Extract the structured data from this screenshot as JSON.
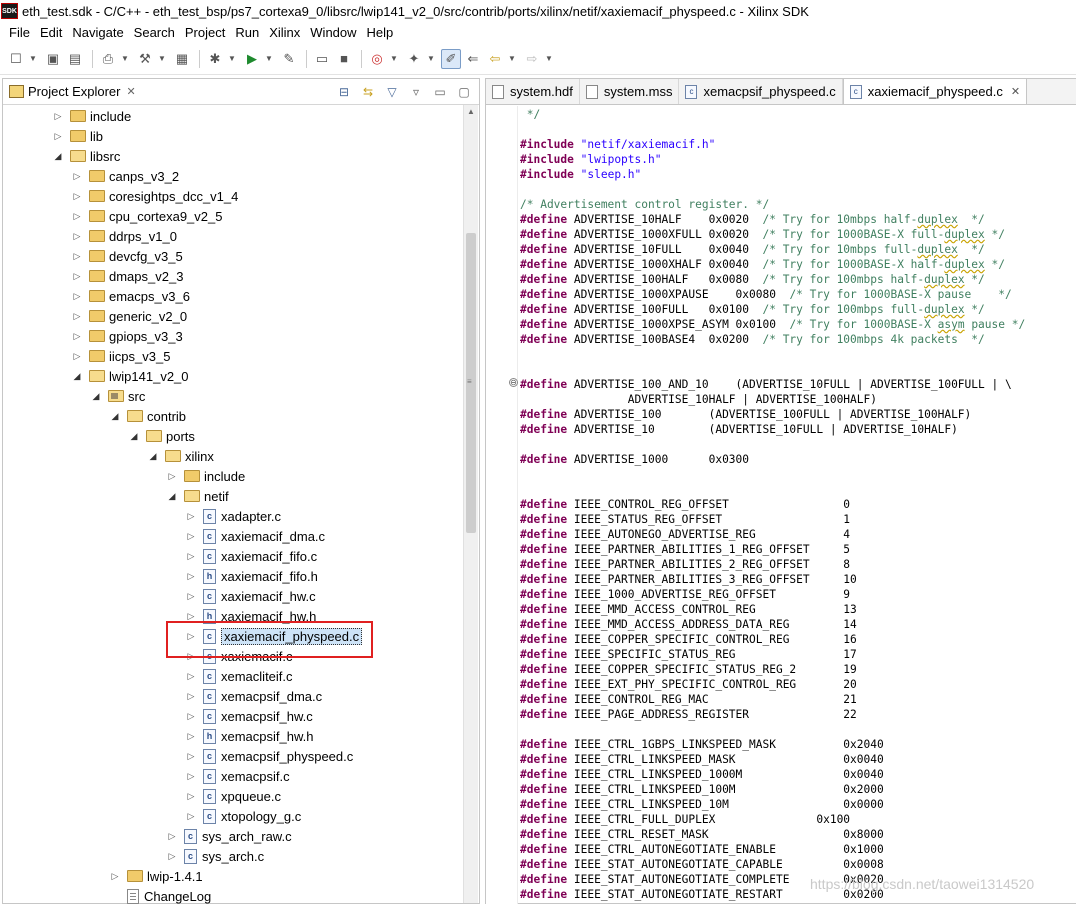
{
  "window": {
    "title": "eth_test.sdk - C/C++ - eth_test_bsp/ps7_cortexa9_0/libsrc/lwip141_v2_0/src/contrib/ports/xilinx/netif/xaxiemacif_physpeed.c - Xilinx SDK",
    "logo_text": "SDK"
  },
  "menu": [
    "File",
    "Edit",
    "Navigate",
    "Search",
    "Project",
    "Run",
    "Xilinx",
    "Window",
    "Help"
  ],
  "toolbar": {
    "icons": [
      "new-icon",
      "save-icon",
      "save-all-icon",
      "print-icon",
      "build-icon",
      "hammer-icon",
      "binary-icon",
      "debug-icon",
      "run-icon",
      "external-tool-icon",
      "terminal-icon",
      "console-icon",
      "target-icon",
      "wand-icon",
      "highlight-icon",
      "back-icon",
      "forward-icon"
    ]
  },
  "project_explorer": {
    "title": "Project Explorer",
    "close_glyph": "✕",
    "tree": [
      {
        "label": "include",
        "type": "folder",
        "depth": 0,
        "expanded": false
      },
      {
        "label": "lib",
        "type": "folder",
        "depth": 0,
        "expanded": false
      },
      {
        "label": "libsrc",
        "type": "folder",
        "depth": 0,
        "expanded": true
      },
      {
        "label": "canps_v3_2",
        "type": "folder",
        "depth": 1,
        "expanded": false
      },
      {
        "label": "coresightps_dcc_v1_4",
        "type": "folder",
        "depth": 1,
        "expanded": false
      },
      {
        "label": "cpu_cortexa9_v2_5",
        "type": "folder",
        "depth": 1,
        "expanded": false
      },
      {
        "label": "ddrps_v1_0",
        "type": "folder",
        "depth": 1,
        "expanded": false
      },
      {
        "label": "devcfg_v3_5",
        "type": "folder",
        "depth": 1,
        "expanded": false
      },
      {
        "label": "dmaps_v2_3",
        "type": "folder",
        "depth": 1,
        "expanded": false
      },
      {
        "label": "emacps_v3_6",
        "type": "folder",
        "depth": 1,
        "expanded": false
      },
      {
        "label": "generic_v2_0",
        "type": "folder",
        "depth": 1,
        "expanded": false
      },
      {
        "label": "gpiops_v3_3",
        "type": "folder",
        "depth": 1,
        "expanded": false
      },
      {
        "label": "iicps_v3_5",
        "type": "folder",
        "depth": 1,
        "expanded": false
      },
      {
        "label": "lwip141_v2_0",
        "type": "folder",
        "depth": 1,
        "expanded": true
      },
      {
        "label": "src",
        "type": "src",
        "depth": 2,
        "expanded": true
      },
      {
        "label": "contrib",
        "type": "folder",
        "depth": 3,
        "expanded": true
      },
      {
        "label": "ports",
        "type": "folder",
        "depth": 4,
        "expanded": true
      },
      {
        "label": "xilinx",
        "type": "folder",
        "depth": 5,
        "expanded": true
      },
      {
        "label": "include",
        "type": "folder",
        "depth": 6,
        "expanded": false
      },
      {
        "label": "netif",
        "type": "folder",
        "depth": 6,
        "expanded": true
      },
      {
        "label": "xadapter.c",
        "type": "c",
        "depth": 7,
        "expanded": false
      },
      {
        "label": "xaxiemacif_dma.c",
        "type": "c",
        "depth": 7,
        "expanded": false
      },
      {
        "label": "xaxiemacif_fifo.c",
        "type": "c",
        "depth": 7,
        "expanded": false
      },
      {
        "label": "xaxiemacif_fifo.h",
        "type": "h",
        "depth": 7,
        "expanded": false
      },
      {
        "label": "xaxiemacif_hw.c",
        "type": "c",
        "depth": 7,
        "expanded": false
      },
      {
        "label": "xaxiemacif_hw.h",
        "type": "h",
        "depth": 7,
        "expanded": false
      },
      {
        "label": "xaxiemacif_physpeed.c",
        "type": "c",
        "depth": 7,
        "expanded": false,
        "selected": true
      },
      {
        "label": "xaxiemacif.c",
        "type": "c",
        "depth": 7,
        "expanded": false
      },
      {
        "label": "xemacliteif.c",
        "type": "c",
        "depth": 7,
        "expanded": false
      },
      {
        "label": "xemacpsif_dma.c",
        "type": "c",
        "depth": 7,
        "expanded": false
      },
      {
        "label": "xemacpsif_hw.c",
        "type": "c",
        "depth": 7,
        "expanded": false
      },
      {
        "label": "xemacpsif_hw.h",
        "type": "h",
        "depth": 7,
        "expanded": false
      },
      {
        "label": "xemacpsif_physpeed.c",
        "type": "c",
        "depth": 7,
        "expanded": false
      },
      {
        "label": "xemacpsif.c",
        "type": "c",
        "depth": 7,
        "expanded": false
      },
      {
        "label": "xpqueue.c",
        "type": "c",
        "depth": 7,
        "expanded": false
      },
      {
        "label": "xtopology_g.c",
        "type": "c",
        "depth": 7,
        "expanded": false
      },
      {
        "label": "sys_arch_raw.c",
        "type": "c",
        "depth": 6,
        "expanded": false
      },
      {
        "label": "sys_arch.c",
        "type": "c",
        "depth": 6,
        "expanded": false
      },
      {
        "label": "lwip-1.4.1",
        "type": "folder",
        "depth": 3,
        "expanded": false
      },
      {
        "label": "ChangeLog",
        "type": "txt",
        "depth": 3,
        "expanded": null
      }
    ]
  },
  "editor": {
    "tabs": [
      {
        "label": "system.hdf",
        "icon": "doc",
        "active": false
      },
      {
        "label": "system.mss",
        "icon": "doc",
        "active": false
      },
      {
        "label": "xemacpsif_physpeed.c",
        "icon": "c",
        "active": false
      },
      {
        "label": "xaxiemacif_physpeed.c",
        "icon": "c",
        "active": true
      }
    ],
    "fold_marker": "⊖",
    "code_lines": [
      [
        [
          "c",
          " */"
        ]
      ],
      [],
      [
        [
          "k",
          "#include"
        ],
        [
          "t",
          " "
        ],
        [
          "s",
          "\"netif/xaxiemacif.h\""
        ]
      ],
      [
        [
          "k",
          "#include"
        ],
        [
          "t",
          " "
        ],
        [
          "s",
          "\"lwipopts.h\""
        ]
      ],
      [
        [
          "k",
          "#include"
        ],
        [
          "t",
          " "
        ],
        [
          "s",
          "\"sleep.h\""
        ]
      ],
      [],
      [
        [
          "c",
          "/* Advertisement control register. */"
        ]
      ],
      [
        [
          "k",
          "#define"
        ],
        [
          "t",
          " ADVERTISE_10HALF    0x0020  "
        ],
        [
          "c",
          "/* Try for 10mbps half-"
        ],
        [
          "q",
          "duplex"
        ],
        [
          "c",
          "  */"
        ]
      ],
      [
        [
          "k",
          "#define"
        ],
        [
          "t",
          " ADVERTISE_1000XFULL 0x0020  "
        ],
        [
          "c",
          "/* Try for 1000BASE-X full-"
        ],
        [
          "q",
          "duplex"
        ],
        [
          "c",
          " */"
        ]
      ],
      [
        [
          "k",
          "#define"
        ],
        [
          "t",
          " ADVERTISE_10FULL    0x0040  "
        ],
        [
          "c",
          "/* Try for 10mbps full-"
        ],
        [
          "q",
          "duplex"
        ],
        [
          "c",
          "  */"
        ]
      ],
      [
        [
          "k",
          "#define"
        ],
        [
          "t",
          " ADVERTISE_1000XHALF 0x0040  "
        ],
        [
          "c",
          "/* Try for 1000BASE-X half-"
        ],
        [
          "q",
          "duplex"
        ],
        [
          "c",
          " */"
        ]
      ],
      [
        [
          "k",
          "#define"
        ],
        [
          "t",
          " ADVERTISE_100HALF   0x0080  "
        ],
        [
          "c",
          "/* Try for 100mbps half-"
        ],
        [
          "q",
          "duplex"
        ],
        [
          "c",
          " */"
        ]
      ],
      [
        [
          "k",
          "#define"
        ],
        [
          "t",
          " ADVERTISE_1000XPAUSE    0x0080  "
        ],
        [
          "c",
          "/* Try for 1000BASE-X pause    */"
        ]
      ],
      [
        [
          "k",
          "#define"
        ],
        [
          "t",
          " ADVERTISE_100FULL   0x0100  "
        ],
        [
          "c",
          "/* Try for 100mbps full-"
        ],
        [
          "q",
          "duplex"
        ],
        [
          "c",
          " */"
        ]
      ],
      [
        [
          "k",
          "#define"
        ],
        [
          "t",
          " ADVERTISE_1000XPSE_ASYM 0x0100  "
        ],
        [
          "c",
          "/* Try for 1000BASE-X "
        ],
        [
          "q",
          "asym"
        ],
        [
          "c",
          " pause */"
        ]
      ],
      [
        [
          "k",
          "#define"
        ],
        [
          "t",
          " ADVERTISE_100BASE4  0x0200  "
        ],
        [
          "c",
          "/* Try for 100mbps 4k packets  */"
        ]
      ],
      [],
      [],
      [
        [
          "k",
          "#define"
        ],
        [
          "t",
          " ADVERTISE_100_AND_10    (ADVERTISE_10FULL | ADVERTISE_100FULL | \\"
        ]
      ],
      [
        [
          "t",
          "                ADVERTISE_10HALF | ADVERTISE_100HALF)"
        ]
      ],
      [
        [
          "k",
          "#define"
        ],
        [
          "t",
          " ADVERTISE_100       (ADVERTISE_100FULL | ADVERTISE_100HALF)"
        ]
      ],
      [
        [
          "k",
          "#define"
        ],
        [
          "t",
          " ADVERTISE_10        (ADVERTISE_10FULL | ADVERTISE_10HALF)"
        ]
      ],
      [],
      [
        [
          "k",
          "#define"
        ],
        [
          "t",
          " ADVERTISE_1000      0x0300"
        ]
      ],
      [],
      [],
      [
        [
          "k",
          "#define"
        ],
        [
          "t",
          " IEEE_CONTROL_REG_OFFSET                 0"
        ]
      ],
      [
        [
          "k",
          "#define"
        ],
        [
          "t",
          " IEEE_STATUS_REG_OFFSET                  1"
        ]
      ],
      [
        [
          "k",
          "#define"
        ],
        [
          "t",
          " IEEE_AUTONEGO_ADVERTISE_REG             4"
        ]
      ],
      [
        [
          "k",
          "#define"
        ],
        [
          "t",
          " IEEE_PARTNER_ABILITIES_1_REG_OFFSET     5"
        ]
      ],
      [
        [
          "k",
          "#define"
        ],
        [
          "t",
          " IEEE_PARTNER_ABILITIES_2_REG_OFFSET     8"
        ]
      ],
      [
        [
          "k",
          "#define"
        ],
        [
          "t",
          " IEEE_PARTNER_ABILITIES_3_REG_OFFSET     10"
        ]
      ],
      [
        [
          "k",
          "#define"
        ],
        [
          "t",
          " IEEE_1000_ADVERTISE_REG_OFFSET          9"
        ]
      ],
      [
        [
          "k",
          "#define"
        ],
        [
          "t",
          " IEEE_MMD_ACCESS_CONTROL_REG             13"
        ]
      ],
      [
        [
          "k",
          "#define"
        ],
        [
          "t",
          " IEEE_MMD_ACCESS_ADDRESS_DATA_REG        14"
        ]
      ],
      [
        [
          "k",
          "#define"
        ],
        [
          "t",
          " IEEE_COPPER_SPECIFIC_CONTROL_REG        16"
        ]
      ],
      [
        [
          "k",
          "#define"
        ],
        [
          "t",
          " IEEE_SPECIFIC_STATUS_REG                17"
        ]
      ],
      [
        [
          "k",
          "#define"
        ],
        [
          "t",
          " IEEE_COPPER_SPECIFIC_STATUS_REG_2       19"
        ]
      ],
      [
        [
          "k",
          "#define"
        ],
        [
          "t",
          " IEEE_EXT_PHY_SPECIFIC_CONTROL_REG       20"
        ]
      ],
      [
        [
          "k",
          "#define"
        ],
        [
          "t",
          " IEEE_CONTROL_REG_MAC                    21"
        ]
      ],
      [
        [
          "k",
          "#define"
        ],
        [
          "t",
          " IEEE_PAGE_ADDRESS_REGISTER              22"
        ]
      ],
      [],
      [
        [
          "k",
          "#define"
        ],
        [
          "t",
          " IEEE_CTRL_1GBPS_LINKSPEED_MASK          0x2040"
        ]
      ],
      [
        [
          "k",
          "#define"
        ],
        [
          "t",
          " IEEE_CTRL_LINKSPEED_MASK                0x0040"
        ]
      ],
      [
        [
          "k",
          "#define"
        ],
        [
          "t",
          " IEEE_CTRL_LINKSPEED_1000M               0x0040"
        ]
      ],
      [
        [
          "k",
          "#define"
        ],
        [
          "t",
          " IEEE_CTRL_LINKSPEED_100M                0x2000"
        ]
      ],
      [
        [
          "k",
          "#define"
        ],
        [
          "t",
          " IEEE_CTRL_LINKSPEED_10M                 0x0000"
        ]
      ],
      [
        [
          "k",
          "#define"
        ],
        [
          "t",
          " IEEE_CTRL_FULL_DUPLEX               0x100"
        ]
      ],
      [
        [
          "k",
          "#define"
        ],
        [
          "t",
          " IEEE_CTRL_RESET_MASK                    0x8000"
        ]
      ],
      [
        [
          "k",
          "#define"
        ],
        [
          "t",
          " IEEE_CTRL_AUTONEGOTIATE_ENABLE          0x1000"
        ]
      ],
      [
        [
          "k",
          "#define"
        ],
        [
          "t",
          " IEEE_STAT_AUTONEGOTIATE_CAPABLE         0x0008"
        ]
      ],
      [
        [
          "k",
          "#define"
        ],
        [
          "t",
          " IEEE_STAT_AUTONEGOTIATE_COMPLETE        0x0020"
        ]
      ],
      [
        [
          "k",
          "#define"
        ],
        [
          "t",
          " IEEE_STAT_AUTONEGOTIATE_RESTART         0x0200"
        ]
      ]
    ]
  },
  "watermark": "https://blog.csdn.net/taowei1314520"
}
